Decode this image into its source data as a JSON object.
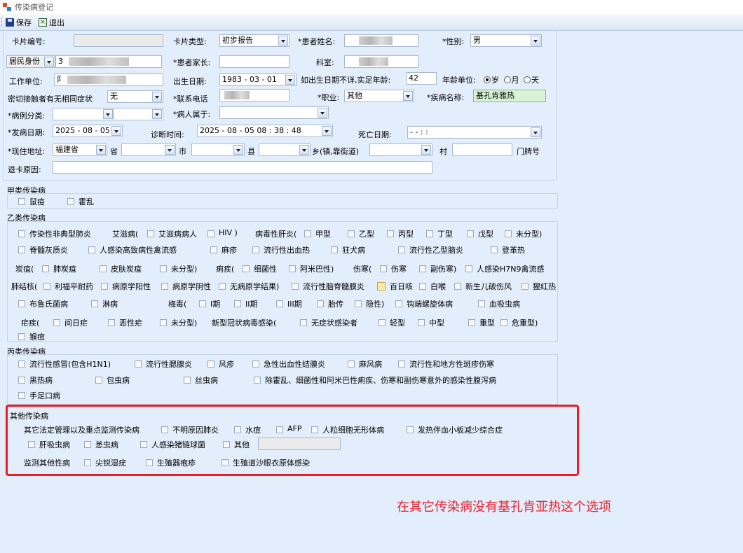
{
  "window": {
    "title": "传染病登记"
  },
  "toolbar": {
    "save": "保存",
    "exit": "退出"
  },
  "form": {
    "card_no": {
      "label": "卡片编号:",
      "value": ""
    },
    "card_type": {
      "label": "卡片类型:",
      "value": "初步报告"
    },
    "patient_name": {
      "label": "*患者姓名:"
    },
    "gender": {
      "label": "*性别:",
      "value": "男"
    },
    "id_type": {
      "value": "居民身份"
    },
    "id_prefix": "3",
    "guardian": {
      "label": "*患者家长:",
      "value": ""
    },
    "department": {
      "label": "科室:"
    },
    "work_unit": {
      "label": "工作单位:",
      "prefix": "阝"
    },
    "birth_date": {
      "label": "出生日期:",
      "value": "1983 - 03 - 01"
    },
    "age": {
      "label": "如出生日期不详,实足年龄:",
      "value": "42"
    },
    "age_unit": {
      "label": "年龄单位:",
      "options": [
        "岁",
        "月",
        "天"
      ],
      "selected": "岁"
    },
    "close_contact": {
      "label": "密切接触者有无相同症状",
      "value": "无"
    },
    "phone": {
      "label": "*联系电话"
    },
    "occupation": {
      "label": "*职业:",
      "value": "其他"
    },
    "disease_name": {
      "label": "*疾病名称:",
      "value": "基孔肯雅热"
    },
    "case_class": {
      "label": "*病例分类:"
    },
    "belongs": {
      "label": "*病人属于:"
    },
    "onset_date": {
      "label": "*发病日期:",
      "value": "2025 - 08 - 05"
    },
    "diagnosis_time": {
      "label": "诊断时间:",
      "value": "2025 - 08 - 05   08 : 38 : 48"
    },
    "death_date": {
      "label": "死亡日期:",
      "value": "-   -        :   :"
    },
    "address": {
      "label": "*现住地址:",
      "province_value": "福建省",
      "province": "省",
      "city": "市",
      "county": "县",
      "township": "乡(镇,靠街道)",
      "village": "村",
      "house_no": "门牌号"
    },
    "refund_reason": {
      "label": "退卡原因:"
    }
  },
  "class_a": {
    "title": "甲类传染病",
    "items": [
      "鼠疫",
      "霍乱"
    ]
  },
  "class_b": {
    "title": "乙类传染病",
    "r1": [
      "传染性非典型肺炎",
      "艾滋病(",
      "艾滋病病人",
      "HIV )",
      "病毒性肝炎(",
      "甲型",
      "乙型",
      "丙型",
      "丁型",
      "戊型",
      "未分型)"
    ],
    "r2": [
      "脊髓灰质炎",
      "人感染高致病性禽流感",
      "麻疹",
      "流行性出血热",
      "狂犬病",
      "流行性乙型脑炎",
      "登革热"
    ],
    "r3": [
      "炭疽(",
      "肺炭疽",
      "皮肤炭疽",
      "未分型)",
      "痢疾(",
      "细菌性",
      "阿米巴性)",
      "伤寒(",
      "伤寒",
      "副伤寒)",
      "人感染H7N9禽流感"
    ],
    "r4": [
      "肺结核(",
      "利福平耐药",
      "病原学阳性",
      "病原学阴性",
      "无病原学结果)",
      "流行性脑脊髓膜炎",
      "百日咳",
      "白喉",
      "新生儿破伤风",
      "猩红热"
    ],
    "r5": [
      "布鲁氏菌病",
      "淋病",
      "梅毒(",
      "I期",
      "II期",
      "III期",
      "胎传",
      "隐性)",
      "钩端螺旋体病",
      "血吸虫病"
    ],
    "r6": [
      "疟疾(",
      "间日疟",
      "恶性疟",
      "未分型)",
      "新型冠状病毒感染(",
      "无症状感染者",
      "轻型",
      "中型",
      "重型",
      "危重型)"
    ],
    "r7": [
      "猴痘"
    ]
  },
  "class_c": {
    "title": "丙类传染病",
    "r1": [
      "流行性感冒(包含H1N1)",
      "流行性腮腺炎",
      "风疹",
      "急性出血性结膜炎",
      "麻风病",
      "流行性和地方性斑疹伤寒"
    ],
    "r2": [
      "黑热病",
      "包虫病",
      "丝虫病",
      "除霍乱、细菌性和阿米巴性痢疾、伤寒和副伤寒意外的感染性腹泻病"
    ],
    "r3": [
      "手足口病"
    ]
  },
  "other": {
    "title": "其他传染病",
    "r1": [
      "其它法定管理以及重点监测传染病",
      "不明原因肺炎",
      "水痘",
      "AFP",
      "人粒细胞无形体病",
      "发热伴血小板减少综合症"
    ],
    "r2": [
      "肝吸虫病",
      "恙虫病",
      "人感染猪链球菌",
      "其他"
    ],
    "r3": [
      "监测其他性病",
      "尖锐湿疣",
      "生殖器疱疹",
      "生殖道沙眼衣原体感染"
    ]
  },
  "annotation": {
    "text": "在其它传染病没有基孔肯亚热这个选项"
  },
  "colors": {
    "background": "#e2eefb",
    "highlight_border": "#ea1c24",
    "annotation_text": "#e8212e",
    "disease_field": "#d9f3d6"
  }
}
